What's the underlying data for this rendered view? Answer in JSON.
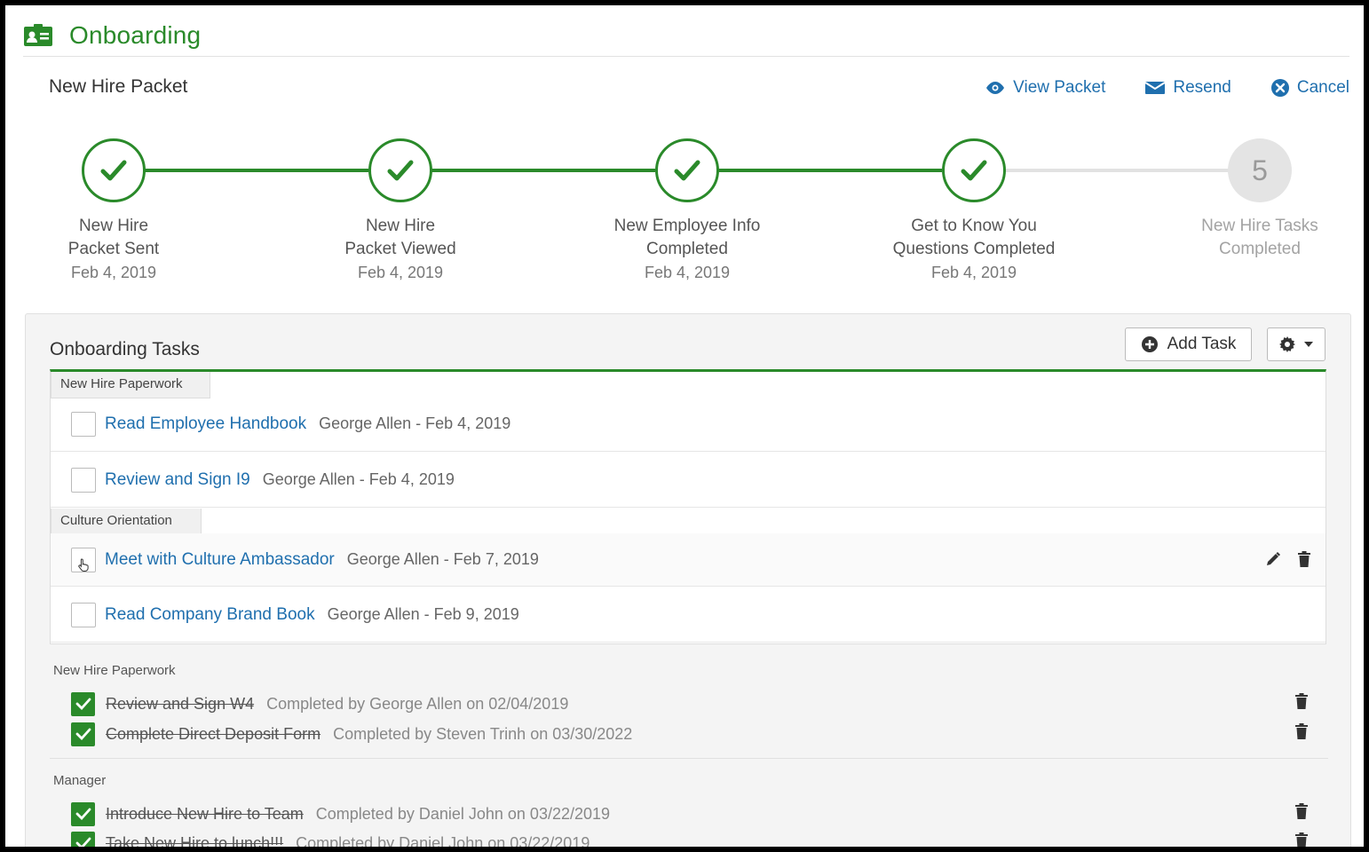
{
  "header": {
    "title": "Onboarding",
    "icon": "id-card-icon"
  },
  "packet": {
    "title": "New Hire Packet",
    "actions": [
      {
        "label": "View Packet",
        "icon": "eye-icon"
      },
      {
        "label": "Resend",
        "icon": "envelope-icon"
      },
      {
        "label": "Cancel",
        "icon": "close-circle-icon"
      }
    ]
  },
  "steps": [
    {
      "line1": "New Hire",
      "line2": "Packet Sent",
      "date": "Feb 4, 2019",
      "status": "complete"
    },
    {
      "line1": "New Hire",
      "line2": "Packet Viewed",
      "date": "Feb 4, 2019",
      "status": "complete"
    },
    {
      "line1": "New Employee Info",
      "line2": "Completed",
      "date": "Feb 4, 2019",
      "status": "complete"
    },
    {
      "line1": "Get to Know You",
      "line2": "Questions Completed",
      "date": "Feb 4, 2019",
      "status": "complete"
    },
    {
      "number": "5",
      "line1": "New Hire Tasks",
      "line2": "Completed",
      "date": "",
      "status": "pending"
    }
  ],
  "tasks": {
    "title": "Onboarding Tasks",
    "add_label": "Add Task",
    "open_groups": [
      {
        "name": "New Hire Paperwork",
        "items": [
          {
            "title": "Read Employee Handbook",
            "meta": "George Allen - Feb 4, 2019"
          },
          {
            "title": "Review and Sign I9",
            "meta": "George Allen - Feb 4, 2019"
          }
        ]
      },
      {
        "name": "Culture Orientation",
        "items": [
          {
            "title": "Meet with Culture Ambassador",
            "meta": "George Allen - Feb 7, 2019"
          },
          {
            "title": "Read Company Brand Book",
            "meta": "George Allen - Feb 9, 2019"
          }
        ]
      }
    ],
    "completed_groups": [
      {
        "name": "New Hire Paperwork",
        "items": [
          {
            "title": "Review and Sign W4",
            "meta": "Completed by George Allen on 02/04/2019"
          },
          {
            "title": "Complete Direct Deposit Form",
            "meta": "Completed by Steven Trinh on 03/30/2022"
          }
        ]
      },
      {
        "name": "Manager",
        "items": [
          {
            "title": "Introduce New Hire to Team",
            "meta": "Completed by Daniel John on 03/22/2019"
          },
          {
            "title": "Take New Hire to lunch!!!",
            "meta": "Completed by Daniel John on 03/22/2019"
          }
        ]
      }
    ]
  },
  "colors": {
    "brand_green": "#2a8a2a",
    "link_blue": "#1f6fae",
    "pending_gray": "#e4e4e4"
  }
}
